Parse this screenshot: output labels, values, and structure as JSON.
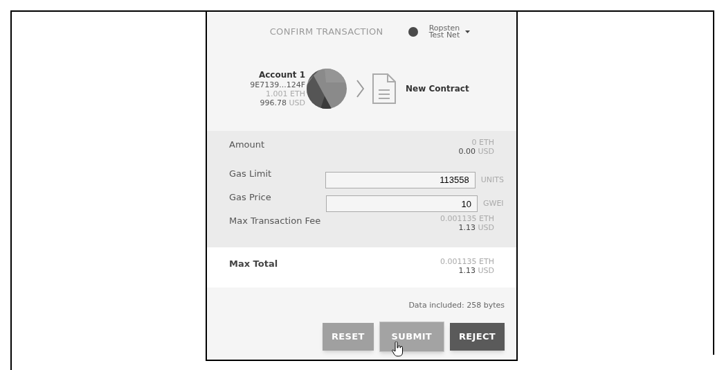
{
  "header": {
    "title": "CONFIRM TRANSACTION",
    "network": {
      "name_line_1": "Ropsten",
      "name_line_2": "Test Net",
      "color": "#4a4a4a"
    }
  },
  "account": {
    "name": "Account 1",
    "address": "9E7139...124F",
    "eth_value": "1.001",
    "eth_unit": "ETH",
    "usd_value": "996.78",
    "usd_unit": "USD"
  },
  "recipient": {
    "name": "New Contract"
  },
  "details": [
    {
      "kind": "amount",
      "label": "Amount",
      "eth_value": "0",
      "eth_unit": "ETH",
      "usd_value": "0.00",
      "usd_unit": "USD"
    },
    {
      "kind": "input",
      "label": "Gas Limit",
      "value": "113558",
      "unit": "UNITS"
    },
    {
      "kind": "input",
      "label": "Gas Price",
      "value": "10",
      "unit": "GWEI"
    },
    {
      "kind": "amount",
      "label": "Max Transaction Fee",
      "eth_value": "0.001135",
      "eth_unit": "ETH",
      "usd_value": "1.13",
      "usd_unit": "USD"
    }
  ],
  "total": {
    "label": "Max Total",
    "eth_value": "0.001135",
    "eth_unit": "ETH",
    "usd_value": "1.13",
    "usd_unit": "USD"
  },
  "data_included": "Data included: 258 bytes",
  "buttons": [
    {
      "label": "RESET",
      "kind": "light"
    },
    {
      "label": "SUBMIT",
      "kind": "hover"
    },
    {
      "label": "REJECT",
      "kind": "dark"
    }
  ]
}
